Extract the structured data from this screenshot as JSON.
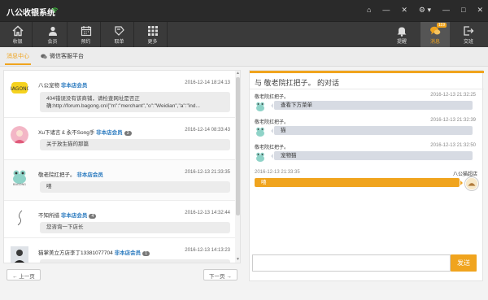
{
  "titlebar": {
    "title": "八公收银系统",
    "controls": [
      "⌂",
      "—",
      "✕",
      "⚙ ▾",
      "—",
      "□",
      "✕"
    ]
  },
  "toolbar": {
    "left": [
      {
        "label": "收银",
        "icon": "home-icon"
      },
      {
        "label": "会员",
        "icon": "members-icon"
      },
      {
        "label": "预约",
        "icon": "calendar-icon"
      },
      {
        "label": "取单",
        "icon": "takeorder-icon"
      },
      {
        "label": "更多",
        "icon": "grid-icon"
      }
    ],
    "right": [
      {
        "label": "提醒",
        "icon": "bell-icon"
      },
      {
        "label": "消息",
        "icon": "chat-icon",
        "badge": "119"
      },
      {
        "label": "交班",
        "icon": "exit-icon"
      }
    ]
  },
  "tabs": [
    {
      "label": "消息中心"
    },
    {
      "label": "微信客服平台"
    }
  ],
  "messages": [
    {
      "name": "八公宠物",
      "member": "非本店会员",
      "count": "",
      "time": "2016-12-14 18:24:13",
      "text": [
        "404错误没有该商铺，请检查网址是否正",
        "确:http://forum.bagong.cn/{\"m\":\"merchant\",\"o\":\"Weidian\",\"a\":\"ind..."
      ]
    },
    {
      "name": "Xu下诸言 £ 永不Song手",
      "member": "非本店会员",
      "count": "3",
      "time": "2016-12-14 08:33:43",
      "text": [
        "关于放生猫的那篇"
      ]
    },
    {
      "name": "敬老院扛把子。",
      "member": "非本店会员",
      "count": "",
      "time": "2016-12-13 21:33:35",
      "text": [
        "嘻"
      ]
    },
    {
      "name": "不知所措",
      "member": "非本店会员",
      "count": "4",
      "time": "2016-12-13 14:32:44",
      "text": [
        "您咨询一下店长"
      ]
    },
    {
      "name": "猫掌美立方店李丁13381077704",
      "member": "非本店会员",
      "count": "1",
      "time": "2016-12-13 14:13:23",
      "text": [
        ""
      ]
    }
  ],
  "pager": {
    "prev": "← 上一页",
    "next": "下一页 →"
  },
  "conversation": {
    "title": "与 敬老院扛把子。 的对话",
    "incoming": [
      {
        "name": "敬老院扛把子。",
        "time": "2016-12-13 21:32:25",
        "text": "查看下方菜单"
      },
      {
        "name": "敬老院扛把子。",
        "time": "2016-12-13 21:32:39",
        "text": "猫"
      },
      {
        "name": "敬老院扛把子。",
        "time": "2016-12-13 21:32:50",
        "text": "宠物猫"
      }
    ],
    "outgoing": {
      "name": "八公猫超店",
      "time": "2016-12-13 21:33:35",
      "text": "嘻"
    }
  },
  "input": {
    "value": ""
  },
  "send_label": "发送",
  "colors": {
    "accent": "#f0a41e",
    "titlebar": "#2a2a2a",
    "toolbar": "#3a3a3a",
    "member": "#2a7abf"
  }
}
